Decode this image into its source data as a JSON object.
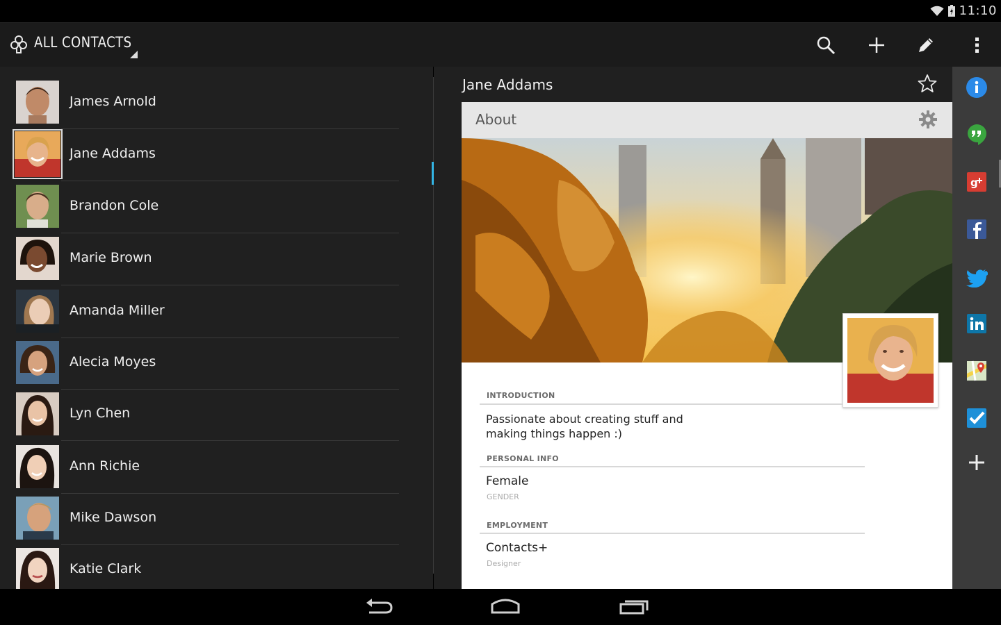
{
  "status": {
    "time": "11:10"
  },
  "actionbar": {
    "title": "ALL CONTACTS",
    "icons": [
      "search-icon",
      "add-icon",
      "edit-icon",
      "overflow-menu-icon"
    ]
  },
  "contacts": [
    {
      "name": "James Arnold",
      "selected": false
    },
    {
      "name": "Jane Addams",
      "selected": true
    },
    {
      "name": "Brandon Cole",
      "selected": false
    },
    {
      "name": "Marie Brown",
      "selected": false
    },
    {
      "name": "Amanda Miller",
      "selected": false
    },
    {
      "name": "Alecia Moyes",
      "selected": false
    },
    {
      "name": "Lyn Chen",
      "selected": false
    },
    {
      "name": "Ann Richie",
      "selected": false
    },
    {
      "name": "Mike Dawson",
      "selected": false
    },
    {
      "name": "Katie Clark",
      "selected": false
    }
  ],
  "detail": {
    "name": "Jane Addams",
    "card_title": "About",
    "introduction": {
      "header": "INTRODUCTION",
      "text": "Passionate about creating stuff and making things happen :)"
    },
    "personal_info": {
      "header": "PERSONAL INFO",
      "value": "Female",
      "label": "GENDER"
    },
    "employment": {
      "header": "EMPLOYMENT",
      "value": "Contacts+",
      "label": "Designer"
    }
  },
  "side_rail": [
    "info-icon",
    "hangouts-icon",
    "google-plus-icon",
    "facebook-icon",
    "twitter-icon",
    "linkedin-icon",
    "maps-icon",
    "tasks-icon",
    "add-icon"
  ],
  "colors": {
    "accent": "#33b5e5",
    "info": "#2b8ae8",
    "hangouts": "#3aa53f",
    "google_plus": "#d73d32",
    "facebook": "#3b5998",
    "twitter": "#1da1f2",
    "linkedin": "#0e76a8"
  }
}
